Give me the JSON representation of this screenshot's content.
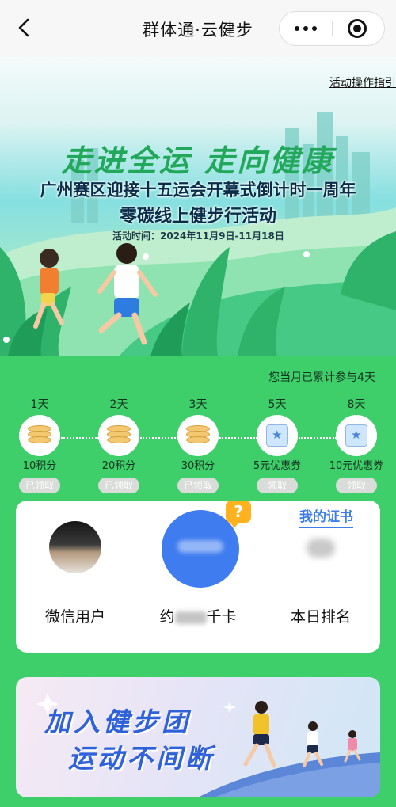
{
  "nav": {
    "title": "群体通·云健步",
    "back_icon": "chevron-left-icon",
    "more_icon": "more-dots-icon",
    "close_icon": "target-close-icon"
  },
  "banner": {
    "guide_link": "活动操作指引",
    "slogan": "走进全运  走向健康",
    "headline": "广州赛区迎接十五运会开幕式倒计时一周年",
    "subheadline": "零碳线上健步行活动",
    "dates": "活动时间：2024年11月9日-11月18日"
  },
  "progress": {
    "total_text": "您当月已累计参与4天",
    "milestones": [
      {
        "day": "1天",
        "reward": "10积分",
        "status": "已领取",
        "icon": "coins-icon"
      },
      {
        "day": "2天",
        "reward": "20积分",
        "status": "已领取",
        "icon": "coins-icon"
      },
      {
        "day": "3天",
        "reward": "30积分",
        "status": "已领取",
        "icon": "coins-icon"
      },
      {
        "day": "5天",
        "reward": "5元优惠券",
        "status": "领取",
        "icon": "coupon-icon"
      },
      {
        "day": "8天",
        "reward": "10元优惠券",
        "status": "领取",
        "icon": "coupon-icon"
      }
    ]
  },
  "card": {
    "user_name": "微信用户",
    "calorie_prefix": "约",
    "calorie_suffix": "千卡",
    "help_badge": "?",
    "cert_link": "我的证书",
    "rank_label": "本日排名"
  },
  "promo": {
    "line1": "加入健步团",
    "line2": "运动不间断"
  },
  "colors": {
    "page_bg": "#3fcf6a",
    "accent_blue": "#3e7cf0",
    "badge_orange": "#ffb21d",
    "slogan_green": "#22a85a"
  }
}
